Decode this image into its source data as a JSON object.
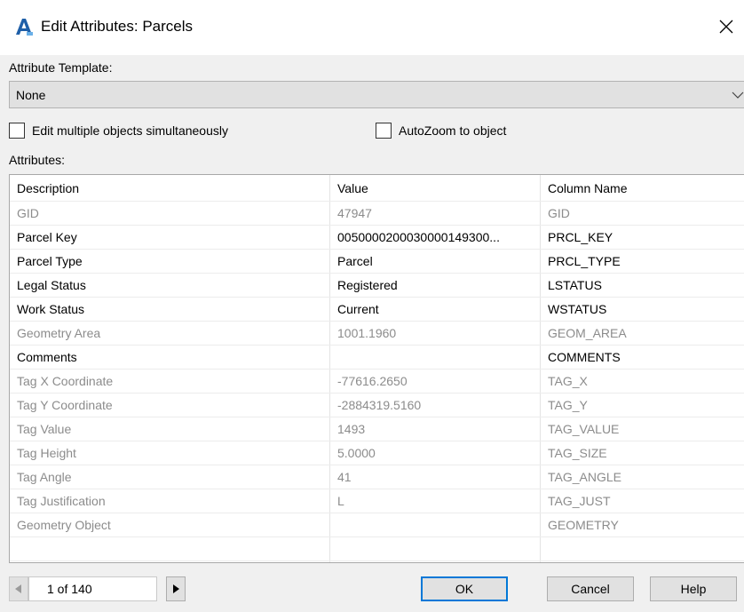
{
  "window": {
    "title": "Edit Attributes: Parcels",
    "close_icon": "close-icon",
    "app_icon": "autocad-map-logo"
  },
  "template": {
    "label": "Attribute Template:",
    "value": "None"
  },
  "options": {
    "edit_multiple_label": "Edit multiple objects simultaneously",
    "edit_multiple_checked": false,
    "autozoom_label": "AutoZoom to object",
    "autozoom_checked": false
  },
  "attributes": {
    "label": "Attributes:",
    "headers": [
      "Description",
      "Value",
      "Column Name"
    ],
    "rows": [
      {
        "description": "GID",
        "value": "47947",
        "column": "GID",
        "editable": false
      },
      {
        "description": "Parcel Key",
        "value": "0050000200030000149300...",
        "column": "PRCL_KEY",
        "editable": true
      },
      {
        "description": "Parcel Type",
        "value": "Parcel",
        "column": "PRCL_TYPE",
        "editable": true
      },
      {
        "description": "Legal Status",
        "value": "Registered",
        "column": "LSTATUS",
        "editable": true
      },
      {
        "description": "Work Status",
        "value": "Current",
        "column": "WSTATUS",
        "editable": true
      },
      {
        "description": "Geometry Area",
        "value": "1001.1960",
        "column": "GEOM_AREA",
        "editable": false
      },
      {
        "description": "Comments",
        "value": "",
        "column": "COMMENTS",
        "editable": true
      },
      {
        "description": "Tag X Coordinate",
        "value": "-77616.2650",
        "column": "TAG_X",
        "editable": false
      },
      {
        "description": "Tag Y Coordinate",
        "value": "-2884319.5160",
        "column": "TAG_Y",
        "editable": false
      },
      {
        "description": "Tag Value",
        "value": "1493",
        "column": "TAG_VALUE",
        "editable": false
      },
      {
        "description": "Tag Height",
        "value": "5.0000",
        "column": "TAG_SIZE",
        "editable": false
      },
      {
        "description": "Tag Angle",
        "value": "41",
        "column": "TAG_ANGLE",
        "editable": false
      },
      {
        "description": "Tag Justification",
        "value": "L",
        "column": "TAG_JUST",
        "editable": false
      },
      {
        "description": "Geometry Object",
        "value": "",
        "column": "GEOMETRY",
        "editable": false
      }
    ]
  },
  "navigation": {
    "page_text": "1 of 140",
    "prev_icon": "triangle-left-icon",
    "next_icon": "triangle-right-icon"
  },
  "buttons": {
    "ok": "OK",
    "cancel": "Cancel",
    "help": "Help"
  },
  "colors": {
    "read_only_text": "#8c8c8c",
    "editable_text": "#000000",
    "default_button_border": "#0078d7"
  }
}
